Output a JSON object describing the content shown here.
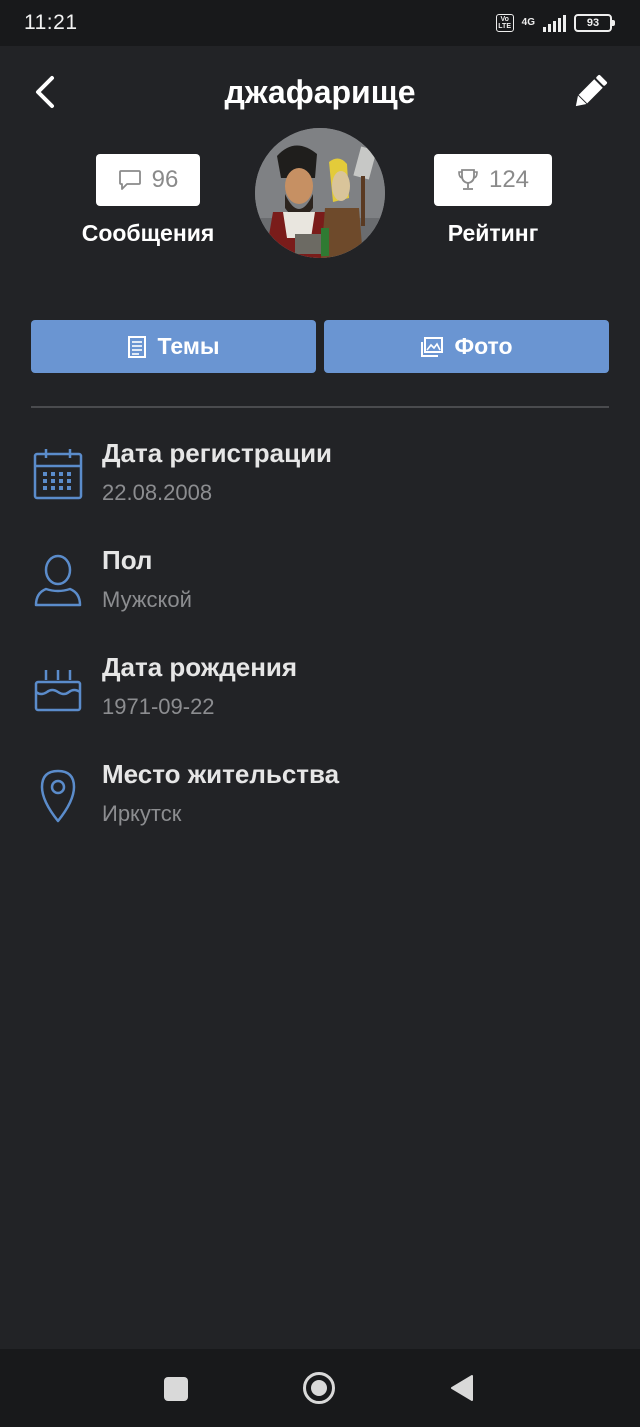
{
  "status": {
    "time": "11:21",
    "volte": "Vo LTE",
    "network": "4G",
    "battery": "93"
  },
  "header": {
    "title": "джафарище"
  },
  "profile": {
    "messages_count": "96",
    "messages_label": "Сообщения",
    "rating_count": "124",
    "rating_label": "Рейтинг"
  },
  "tabs": {
    "topics": "Темы",
    "photos": "Фото"
  },
  "info": [
    {
      "label": "Дата регистрации",
      "value": "22.08.2008",
      "icon": "calendar-icon"
    },
    {
      "label": "Пол",
      "value": "Мужской",
      "icon": "person-icon"
    },
    {
      "label": "Дата рождения",
      "value": "1971-09-22",
      "icon": "birthday-cake-icon"
    },
    {
      "label": "Место жительства",
      "value": "Иркутск",
      "icon": "location-pin-icon"
    }
  ],
  "colors": {
    "background": "#222326",
    "accent": "#6a95d2",
    "icon": "#5b8ccb"
  }
}
